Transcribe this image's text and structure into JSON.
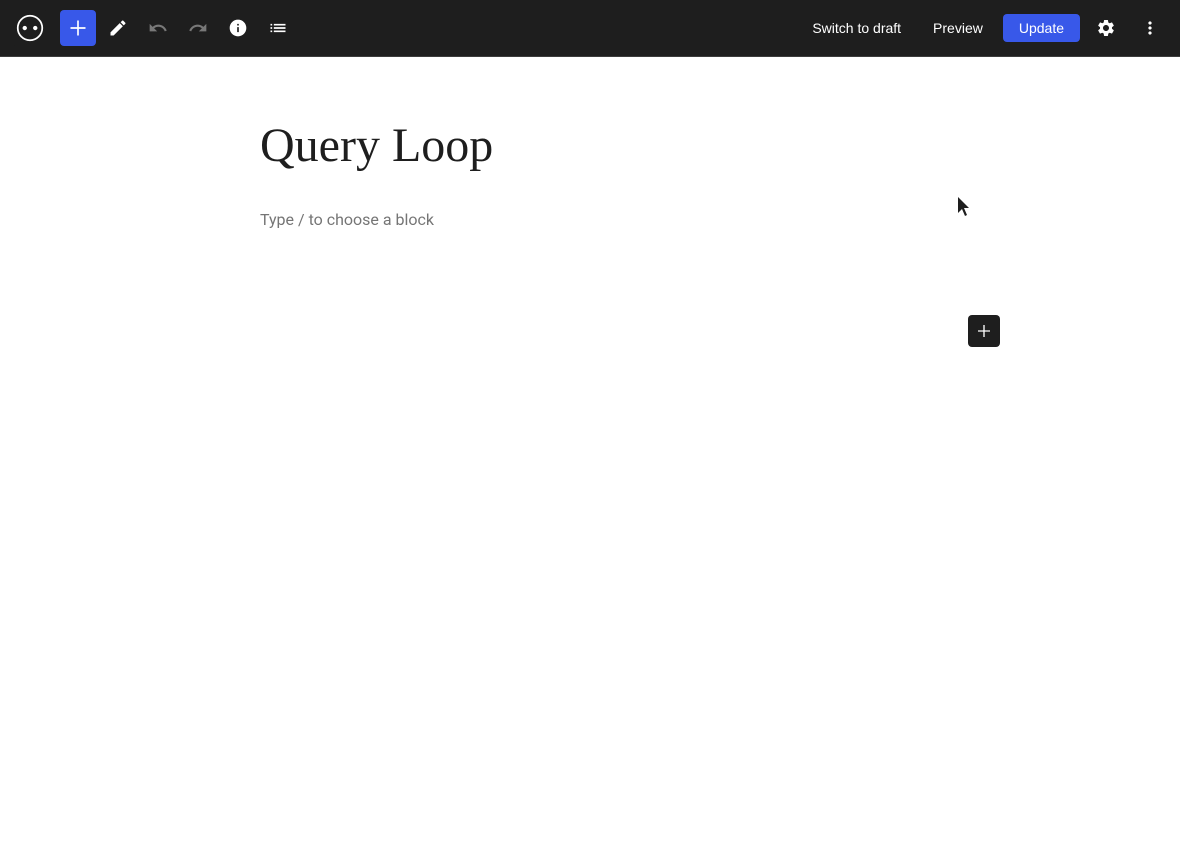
{
  "toolbar": {
    "add_label": "+",
    "switch_to_draft_label": "Switch to draft",
    "preview_label": "Preview",
    "update_label": "Update"
  },
  "editor": {
    "post_title": "Query Loop",
    "block_placeholder": "Type / to choose a block"
  },
  "icons": {
    "pencil": "pencil-icon",
    "undo": "undo-icon",
    "redo": "redo-icon",
    "info": "info-icon",
    "list_view": "list-view-icon",
    "settings": "settings-icon",
    "more_options": "more-options-icon"
  }
}
